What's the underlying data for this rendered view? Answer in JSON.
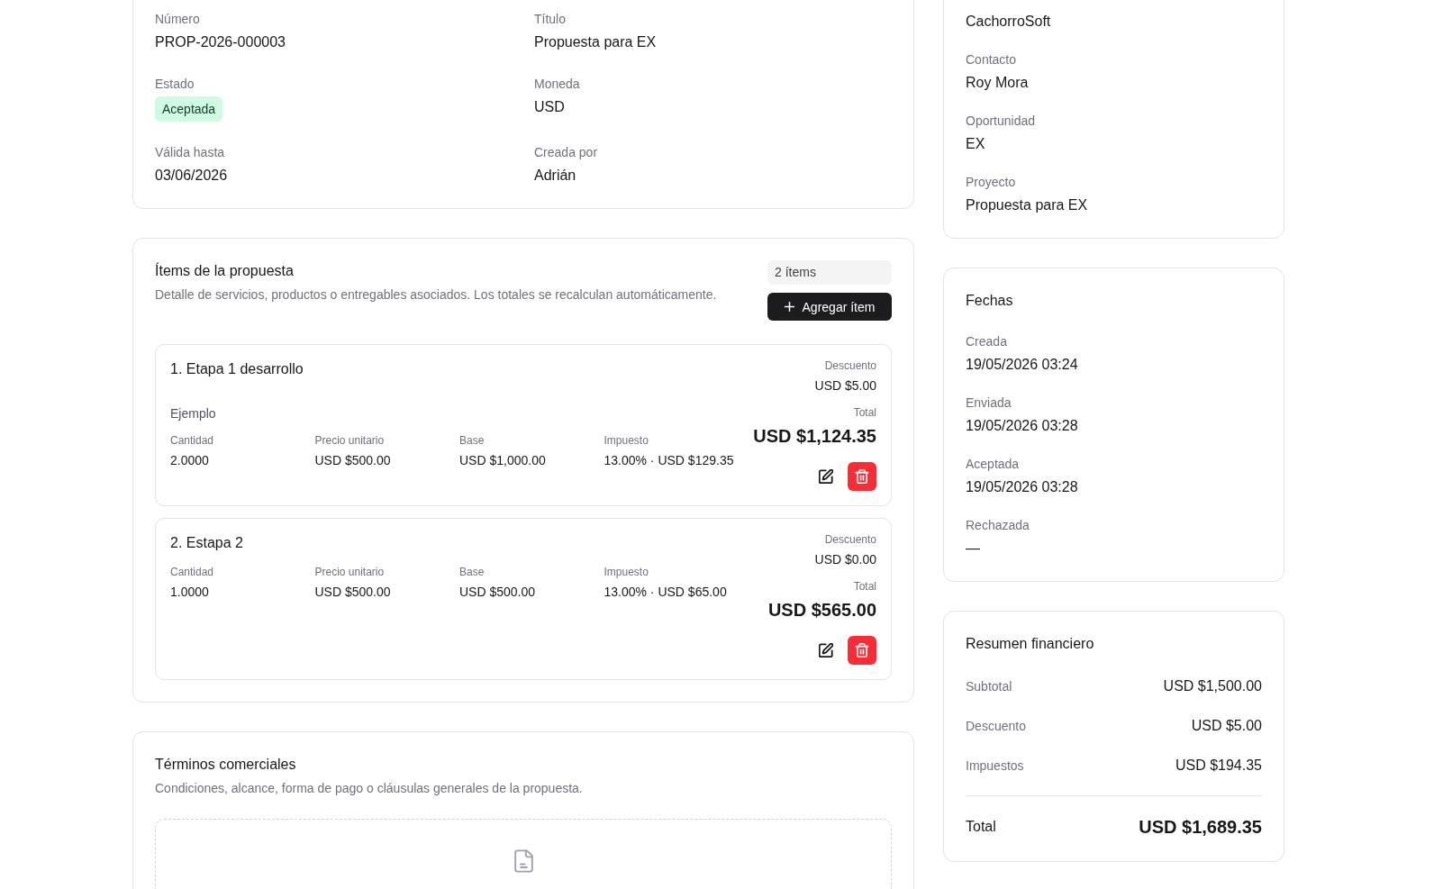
{
  "general": {
    "fields": [
      {
        "label": "Número",
        "value": "PROP-2026-000003",
        "kind": "text"
      },
      {
        "label": "Título",
        "value": "Propuesta para EX",
        "kind": "text"
      },
      {
        "label": "Estado",
        "value": "Aceptada",
        "kind": "badge"
      },
      {
        "label": "Moneda",
        "value": "USD",
        "kind": "text"
      },
      {
        "label": "Válida hasta",
        "value": "03/06/2026",
        "kind": "text"
      },
      {
        "label": "Creada por",
        "value": "Adrián",
        "kind": "text"
      }
    ]
  },
  "items_section": {
    "title": "Ítems de la propuesta",
    "subtitle": "Detalle de servicios, productos o entregables asociados. Los totales se recalculan automáticamente.",
    "count": "2 ítems",
    "add_button": "Agregar ítem",
    "items": [
      {
        "title": "1. Etapa 1 desarrollo",
        "description": "Ejemplo",
        "metrics": [
          {
            "label": "Cantidad",
            "value": "2.0000"
          },
          {
            "label": "Precio unitario",
            "value": "USD $500.00"
          },
          {
            "label": "Base",
            "value": "USD $1,000.00"
          },
          {
            "label": "Impuesto",
            "value": "13.00% · USD $129.35"
          }
        ],
        "discount_label": "Descuento",
        "discount": "USD $5.00",
        "total_label": "Total",
        "total": "USD $1,124.35"
      },
      {
        "title": "2. Estapa 2",
        "metrics": [
          {
            "label": "Cantidad",
            "value": "1.0000"
          },
          {
            "label": "Precio unitario",
            "value": "USD $500.00"
          },
          {
            "label": "Base",
            "value": "USD $500.00"
          },
          {
            "label": "Impuesto",
            "value": "13.00% · USD $65.00"
          }
        ],
        "discount_label": "Descuento",
        "discount": "USD $0.00",
        "total_label": "Total",
        "total": "USD $565.00"
      }
    ]
  },
  "terms": {
    "title": "Términos comerciales",
    "subtitle": "Condiciones, alcance, forma de pago o cláusulas generales de la propuesta."
  },
  "associations": {
    "fields": [
      {
        "value": "CachorroSoft"
      },
      {
        "label": "Contacto",
        "value": "Roy Mora"
      },
      {
        "label": "Oportunidad",
        "value": "EX"
      },
      {
        "label": "Proyecto",
        "value": "Propuesta para EX"
      }
    ]
  },
  "dates": {
    "title": "Fechas",
    "fields": [
      {
        "label": "Creada",
        "value": "19/05/2026 03:24"
      },
      {
        "label": "Enviada",
        "value": "19/05/2026 03:28"
      },
      {
        "label": "Aceptada",
        "value": "19/05/2026 03:28"
      },
      {
        "label": "Rechazada",
        "value": "—"
      }
    ]
  },
  "financial_summary": {
    "title": "Resumen financiero",
    "rows": [
      {
        "label": "Subtotal",
        "value": "USD $1,500.00"
      },
      {
        "label": "Descuento",
        "value": "USD $5.00"
      },
      {
        "label": "Impuestos",
        "value": "USD $194.35"
      }
    ],
    "total": {
      "label": "Total",
      "value": "USD $1,689.35"
    }
  }
}
